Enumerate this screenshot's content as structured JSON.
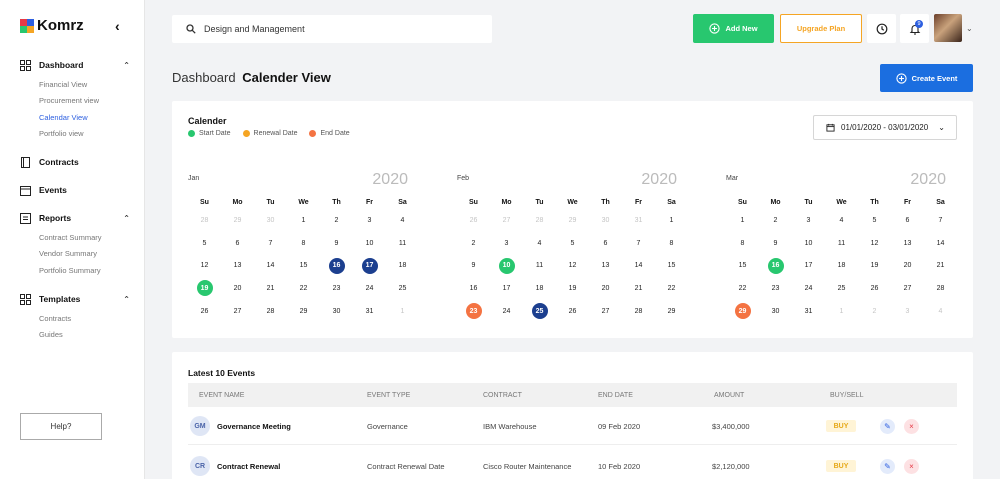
{
  "brand": {
    "name": "Komrz",
    "logo_colors": [
      "#e63946",
      "#2d5fe0",
      "#28c76f",
      "#f5a524"
    ]
  },
  "sidebar": {
    "groups": [
      {
        "label": "Dashboard",
        "icon": "dashboard-icon",
        "expanded": true,
        "items": [
          {
            "label": "Financial View",
            "active": false
          },
          {
            "label": "Procurement view",
            "active": false
          },
          {
            "label": "Calendar View",
            "active": true
          },
          {
            "label": "Portfolio view",
            "active": false
          }
        ]
      },
      {
        "label": "Contracts",
        "icon": "contract-icon",
        "expanded": false,
        "items": []
      },
      {
        "label": "Events",
        "icon": "calendar-icon",
        "expanded": false,
        "items": []
      },
      {
        "label": "Reports",
        "icon": "report-icon",
        "expanded": true,
        "items": [
          {
            "label": "Contract Summary",
            "active": false
          },
          {
            "label": "Vendor Summary",
            "active": false
          },
          {
            "label": "Portfolio Summary",
            "active": false
          }
        ]
      },
      {
        "label": "Templates",
        "icon": "template-icon",
        "expanded": true,
        "items": [
          {
            "label": "Contracts",
            "active": false
          },
          {
            "label": "Guides",
            "active": false
          }
        ]
      }
    ],
    "help_label": "Help?"
  },
  "topbar": {
    "search_value": "Design and Management",
    "add_new_label": "Add New",
    "upgrade_label": "Upgrade Plan",
    "notification_count": "9"
  },
  "page": {
    "crumb_parent": "Dashboard",
    "crumb_current": "Calender View",
    "create_event_label": "Create Event"
  },
  "calendar": {
    "title": "Calender",
    "legend": [
      {
        "label": "Start Date",
        "color": "#28c76f"
      },
      {
        "label": "Renewal Date",
        "color": "#f5a524"
      },
      {
        "label": "End Date",
        "color": "#f47342"
      }
    ],
    "range": "01/01/2020 - 03/01/2020",
    "weekdays": [
      "Su",
      "Mo",
      "Tu",
      "We",
      "Th",
      "Fr",
      "Sa"
    ],
    "colors": {
      "start": "#28c76f",
      "end": "#f47342",
      "highlight": "#1c3f8f"
    },
    "months": [
      {
        "name": "Jan",
        "year": "2020",
        "days": [
          [
            "28",
            "m"
          ],
          [
            "29",
            "m"
          ],
          [
            "30",
            "m"
          ],
          [
            "1",
            ""
          ],
          [
            "2",
            ""
          ],
          [
            "3",
            ""
          ],
          [
            "4",
            ""
          ],
          [
            "5",
            ""
          ],
          [
            "6",
            ""
          ],
          [
            "7",
            ""
          ],
          [
            "8",
            ""
          ],
          [
            "9",
            ""
          ],
          [
            "10",
            ""
          ],
          [
            "11",
            ""
          ],
          [
            "12",
            ""
          ],
          [
            "13",
            ""
          ],
          [
            "14",
            ""
          ],
          [
            "15",
            ""
          ],
          [
            "16",
            "highlight"
          ],
          [
            "17",
            "highlight"
          ],
          [
            "18",
            ""
          ],
          [
            "19",
            "start"
          ],
          [
            "20",
            ""
          ],
          [
            "21",
            ""
          ],
          [
            "22",
            ""
          ],
          [
            "23",
            ""
          ],
          [
            "24",
            ""
          ],
          [
            "25",
            ""
          ],
          [
            "26",
            ""
          ],
          [
            "27",
            ""
          ],
          [
            "28",
            ""
          ],
          [
            "29",
            ""
          ],
          [
            "30",
            ""
          ],
          [
            "31",
            ""
          ],
          [
            "1",
            "m"
          ]
        ]
      },
      {
        "name": "Feb",
        "year": "2020",
        "days": [
          [
            "26",
            "m"
          ],
          [
            "27",
            "m"
          ],
          [
            "28",
            "m"
          ],
          [
            "29",
            "m"
          ],
          [
            "30",
            "m"
          ],
          [
            "31",
            "m"
          ],
          [
            "1",
            ""
          ],
          [
            "2",
            ""
          ],
          [
            "3",
            ""
          ],
          [
            "4",
            ""
          ],
          [
            "5",
            ""
          ],
          [
            "6",
            ""
          ],
          [
            "7",
            ""
          ],
          [
            "8",
            ""
          ],
          [
            "9",
            ""
          ],
          [
            "10",
            "start"
          ],
          [
            "11",
            ""
          ],
          [
            "12",
            ""
          ],
          [
            "13",
            ""
          ],
          [
            "14",
            ""
          ],
          [
            "15",
            ""
          ],
          [
            "16",
            ""
          ],
          [
            "17",
            ""
          ],
          [
            "18",
            ""
          ],
          [
            "19",
            ""
          ],
          [
            "20",
            ""
          ],
          [
            "21",
            ""
          ],
          [
            "22",
            ""
          ],
          [
            "23",
            "end"
          ],
          [
            "24",
            ""
          ],
          [
            "25",
            "highlight"
          ],
          [
            "26",
            ""
          ],
          [
            "27",
            ""
          ],
          [
            "28",
            ""
          ],
          [
            "29",
            ""
          ]
        ]
      },
      {
        "name": "Mar",
        "year": "2020",
        "days": [
          [
            "1",
            ""
          ],
          [
            "2",
            ""
          ],
          [
            "3",
            ""
          ],
          [
            "4",
            ""
          ],
          [
            "5",
            ""
          ],
          [
            "6",
            ""
          ],
          [
            "7",
            ""
          ],
          [
            "8",
            ""
          ],
          [
            "9",
            ""
          ],
          [
            "10",
            ""
          ],
          [
            "11",
            ""
          ],
          [
            "12",
            ""
          ],
          [
            "13",
            ""
          ],
          [
            "14",
            ""
          ],
          [
            "15",
            ""
          ],
          [
            "16",
            "start"
          ],
          [
            "17",
            ""
          ],
          [
            "18",
            ""
          ],
          [
            "19",
            ""
          ],
          [
            "20",
            ""
          ],
          [
            "21",
            ""
          ],
          [
            "22",
            ""
          ],
          [
            "23",
            ""
          ],
          [
            "24",
            ""
          ],
          [
            "25",
            ""
          ],
          [
            "26",
            ""
          ],
          [
            "27",
            ""
          ],
          [
            "28",
            ""
          ],
          [
            "29",
            "end"
          ],
          [
            "30",
            ""
          ],
          [
            "31",
            ""
          ],
          [
            "1",
            "m"
          ],
          [
            "2",
            "m"
          ],
          [
            "3",
            "m"
          ],
          [
            "4",
            "m"
          ]
        ]
      }
    ]
  },
  "events": {
    "title": "Latest 10 Events",
    "columns": [
      "EVENT NAME",
      "EVENT TYPE",
      "CONTRACT",
      "END DATE",
      "AMOUNT",
      "BUY/SELL"
    ],
    "rows": [
      {
        "initials": "GM",
        "name": "Governance Meeting",
        "type": "Governance",
        "contract": "IBM Warehouse",
        "end_date": "09 Feb 2020",
        "amount": "$3,400,000",
        "side": "BUY"
      },
      {
        "initials": "CR",
        "name": "Contract Renewal",
        "type": "Contract Renewal Date",
        "contract": "Cisco Router Maintenance",
        "end_date": "10 Feb 2020",
        "amount": "$2,120,000",
        "side": "BUY"
      }
    ]
  }
}
